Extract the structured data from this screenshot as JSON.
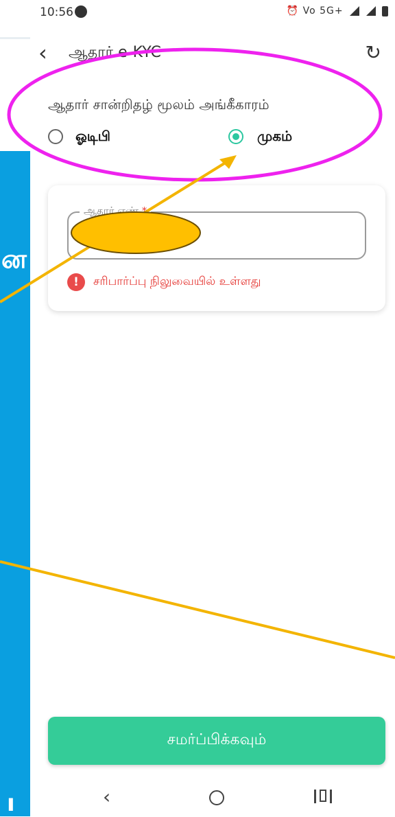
{
  "status": {
    "time": "10:56",
    "right": "⏰ Vo 5G+"
  },
  "header": {
    "title": "ஆதார் e-KYC"
  },
  "auth": {
    "label": "ஆதார் சான்றிதழ் மூலம் அங்கீகாரம்",
    "options": [
      {
        "label": "ஓடிபி",
        "selected": false
      },
      {
        "label": "முகம்",
        "selected": true
      }
    ]
  },
  "form": {
    "field_label": "ஆதார் எண்",
    "required_mark": "*",
    "field_value": "",
    "error": "சரிபார்ப்பு நிலுவையில் உள்ளது"
  },
  "submit_label": "சமர்ப்பிக்கவும்",
  "overlay_panel": {
    "char": "ன",
    "bottom": "ı"
  },
  "colors": {
    "accent": "#2cc7a0",
    "submit": "#34cc98",
    "error": "#e53935",
    "annotation_ring": "#ee22ee",
    "annotation_arrow": "#f3b400",
    "panel_blue": "#0a9fe0"
  }
}
